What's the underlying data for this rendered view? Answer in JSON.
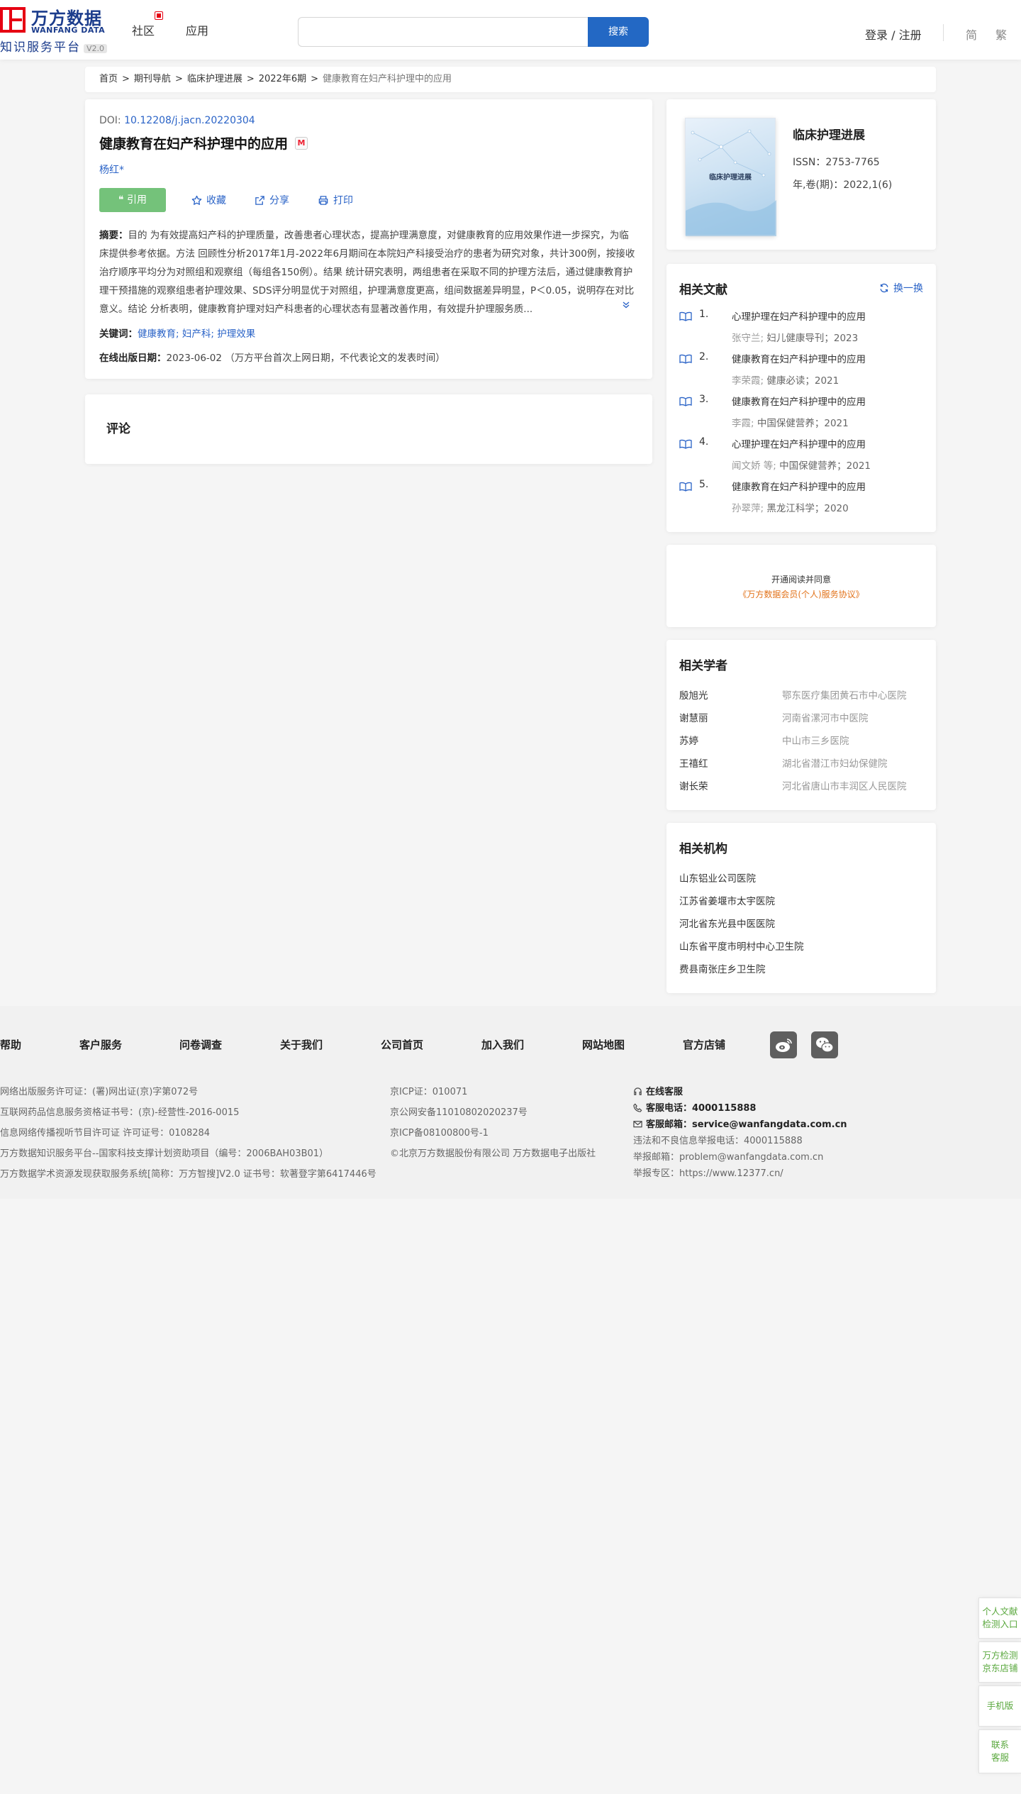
{
  "header": {
    "logo_cn": "万方数据",
    "logo_en": "WANFANG DATA",
    "logo_sub": "知识服务平台",
    "version": "V2.0",
    "nav": [
      "社区",
      "应用"
    ],
    "search_button": "搜索",
    "login": "登录 / 注册",
    "lang_simplified": "简",
    "lang_traditional": "繁"
  },
  "breadcrumb": [
    "首页",
    "期刊导航",
    "临床护理进展",
    "2022年6期",
    "健康教育在妇产科护理中的应用"
  ],
  "article": {
    "doi_label": "DOI: ",
    "doi": "10.12208/j.jacn.20220304",
    "title": "健康教育在妇产科护理中的应用",
    "title_badge": "M",
    "author": "杨红*",
    "actions": {
      "cite": "引用",
      "favorite": "收藏",
      "share": "分享",
      "print": "打印"
    },
    "abstract_label": "摘要：",
    "abstract": "目的 为有效提高妇产科的护理质量，改善患者心理状态，提高护理满意度，对健康教育的应用效果作进一步探究，为临床提供参考依据。方法 回顾性分析2017年1月-2022年6月期间在本院妇产科接受治疗的患者为研究对象，共计300例，按接收治疗顺序平均分为对照组和观察组（每组各150例）。结果 统计研究表明，两组患者在采取不同的护理方法后，通过健康教育护理干预措施的观察组患者护理效果、SDS评分明显优于对照组，护理满意度更高，组间数据差异明显，P＜0.05，说明存在对比意义。结论 分析表明，健康教育护理对妇产科患者的心理状态有显著改善作用，有效提升护理服务质...",
    "expand_icon": "chevron-double-down",
    "keywords_label": "关键词：",
    "keywords": [
      "健康教育;",
      "妇产科;",
      "护理效果"
    ],
    "date_label": "在线出版日期：",
    "date": "2023-06-02 （万方平台首次上网日期，不代表论文的发表时间）"
  },
  "comment": {
    "title": "评论"
  },
  "journal": {
    "cover_title": "临床护理进展",
    "name": "临床护理进展",
    "issn": "ISSN：2753-7765",
    "volume": "年,卷(期)：2022,1(6)"
  },
  "related": {
    "title": "相关文献",
    "refresh": "换一换",
    "items": [
      {
        "num": "1.",
        "title": "心理护理在妇产科护理中的应用",
        "authors": "张守兰;",
        "source": "妇儿健康导刊",
        "year": "；2023"
      },
      {
        "num": "2.",
        "title": "健康教育在妇产科护理中的应用",
        "authors": "李荣霞;",
        "source": "健康必读",
        "year": "；2021"
      },
      {
        "num": "3.",
        "title": "健康教育在妇产科护理中的应用",
        "authors": "李霞;",
        "source": "中国保健营养",
        "year": "；2021"
      },
      {
        "num": "4.",
        "title": "心理护理在妇产科护理中的应用",
        "authors": "闻文娇 等;",
        "source": "中国保健营养",
        "year": "；2021"
      },
      {
        "num": "5.",
        "title": "健康教育在妇产科护理中的应用",
        "authors": "孙翠萍;",
        "source": "黑龙江科学",
        "year": "；2020"
      }
    ]
  },
  "agreement": {
    "line1": "开通阅读并同意",
    "line2": "《万方数据会员(个人)服务协议》"
  },
  "scholars": {
    "title": "相关学者",
    "items": [
      {
        "name": "殷旭光",
        "org": "鄂东医疗集团黄石市中心医院"
      },
      {
        "name": "谢慧丽",
        "org": "河南省漯河市中医院"
      },
      {
        "name": "苏婷",
        "org": "中山市三乡医院"
      },
      {
        "name": "王禧红",
        "org": "湖北省潜江市妇幼保健院"
      },
      {
        "name": "谢长荣",
        "org": "河北省唐山市丰润区人民医院"
      }
    ]
  },
  "orgs": {
    "title": "相关机构",
    "items": [
      "山东铝业公司医院",
      "江苏省姜堰市太宇医院",
      "河北省东光县中医医院",
      "山东省平度市明村中心卫生院",
      "费县南张庄乡卫生院"
    ]
  },
  "footer": {
    "nav": [
      "帮助",
      "客户服务",
      "问卷调查",
      "关于我们",
      "公司首页",
      "加入我们",
      "网站地图",
      "官方店铺"
    ],
    "col1": [
      "网络出版服务许可证：(署)网出证(京)字第072号",
      "互联网药品信息服务资格证书号：(京)-经营性-2016-0015",
      "信息网络传播视听节目许可证 许可证号：0108284",
      "万方数据知识服务平台--国家科技支撑计划资助项目（编号：2006BAH03B01）",
      "万方数据学术资源发现获取服务系统[简称：万方智搜]V2.0 证书号：软著登字第6417446号"
    ],
    "col2": [
      "京ICP证：010071",
      "京公网安备11010802020237号",
      "京ICP备08100800号-1",
      "©北京万方数据股份有限公司 万方数据电子出版社"
    ],
    "online_service": "在线客服",
    "phone_label": "客服电话：",
    "phone": "4000115888",
    "email_label": "客服邮箱：",
    "email": "service@wanfangdata.com.cn",
    "col3": [
      "违法和不良信息举报电话：4000115888",
      "举报邮箱：problem@wanfangdata.com.cn",
      "举报专区：https://www.12377.cn/"
    ]
  },
  "side_tabs": [
    [
      "个人文献",
      "检测入口"
    ],
    [
      "万方检测",
      "京东店铺"
    ],
    [
      "手机版"
    ],
    [
      "联系",
      "客服"
    ]
  ]
}
